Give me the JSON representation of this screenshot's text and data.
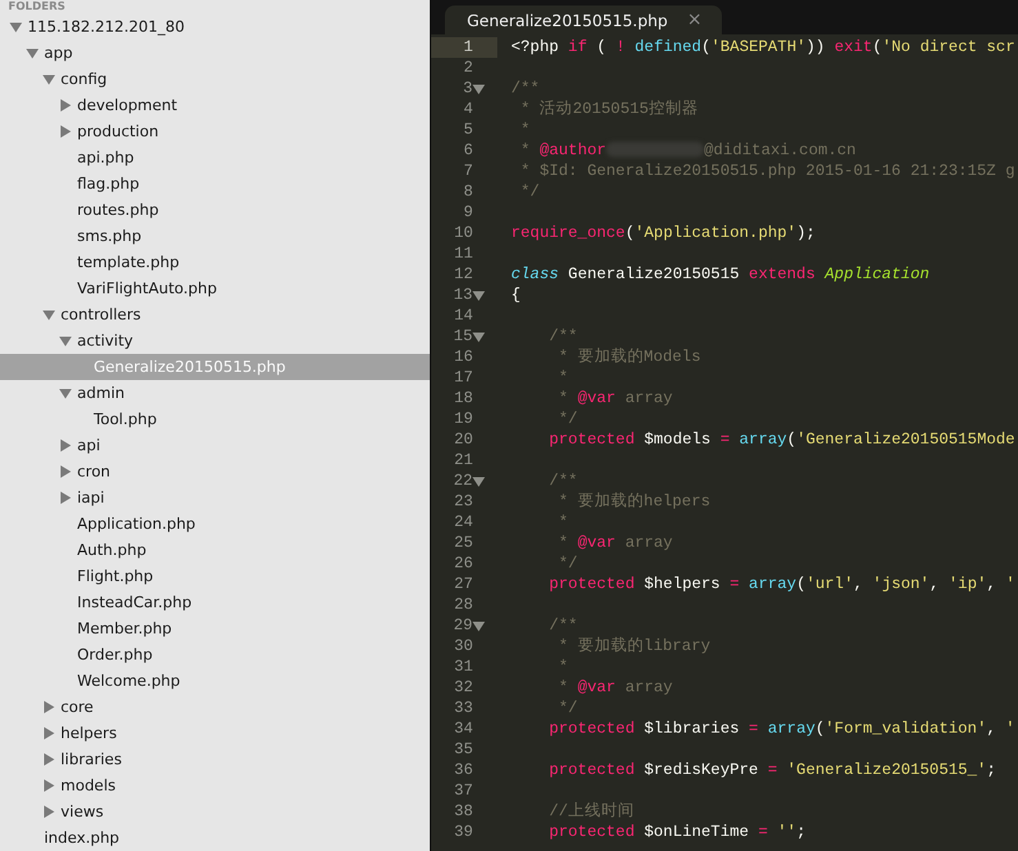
{
  "sidebar": {
    "header": "FOLDERS",
    "tree": [
      {
        "label": "115.182.212.201_80",
        "kind": "folder",
        "expanded": true,
        "selected": false,
        "children": [
          {
            "label": "app",
            "kind": "folder",
            "expanded": true,
            "selected": false,
            "children": [
              {
                "label": "config",
                "kind": "folder",
                "expanded": true,
                "selected": false,
                "children": [
                  {
                    "label": "development",
                    "kind": "folder",
                    "expanded": false,
                    "selected": false
                  },
                  {
                    "label": "production",
                    "kind": "folder",
                    "expanded": false,
                    "selected": false
                  },
                  {
                    "label": "api.php",
                    "kind": "file",
                    "selected": false
                  },
                  {
                    "label": "flag.php",
                    "kind": "file",
                    "selected": false
                  },
                  {
                    "label": "routes.php",
                    "kind": "file",
                    "selected": false
                  },
                  {
                    "label": "sms.php",
                    "kind": "file",
                    "selected": false
                  },
                  {
                    "label": "template.php",
                    "kind": "file",
                    "selected": false
                  },
                  {
                    "label": "VariFlightAuto.php",
                    "kind": "file",
                    "selected": false
                  }
                ]
              },
              {
                "label": "controllers",
                "kind": "folder",
                "expanded": true,
                "selected": false,
                "children": [
                  {
                    "label": "activity",
                    "kind": "folder",
                    "expanded": true,
                    "selected": false,
                    "children": [
                      {
                        "label": "Generalize20150515.php",
                        "kind": "file",
                        "selected": true
                      }
                    ]
                  },
                  {
                    "label": "admin",
                    "kind": "folder",
                    "expanded": true,
                    "selected": false,
                    "children": [
                      {
                        "label": "Tool.php",
                        "kind": "file",
                        "selected": false
                      }
                    ]
                  },
                  {
                    "label": "api",
                    "kind": "folder",
                    "expanded": false,
                    "selected": false
                  },
                  {
                    "label": "cron",
                    "kind": "folder",
                    "expanded": false,
                    "selected": false
                  },
                  {
                    "label": "iapi",
                    "kind": "folder",
                    "expanded": false,
                    "selected": false
                  },
                  {
                    "label": "Application.php",
                    "kind": "file",
                    "selected": false
                  },
                  {
                    "label": "Auth.php",
                    "kind": "file",
                    "selected": false
                  },
                  {
                    "label": "Flight.php",
                    "kind": "file",
                    "selected": false
                  },
                  {
                    "label": "InsteadCar.php",
                    "kind": "file",
                    "selected": false
                  },
                  {
                    "label": "Member.php",
                    "kind": "file",
                    "selected": false
                  },
                  {
                    "label": "Order.php",
                    "kind": "file",
                    "selected": false
                  },
                  {
                    "label": "Welcome.php",
                    "kind": "file",
                    "selected": false
                  }
                ]
              },
              {
                "label": "core",
                "kind": "folder",
                "expanded": false,
                "selected": false
              },
              {
                "label": "helpers",
                "kind": "folder",
                "expanded": false,
                "selected": false
              },
              {
                "label": "libraries",
                "kind": "folder",
                "expanded": false,
                "selected": false
              },
              {
                "label": "models",
                "kind": "folder",
                "expanded": false,
                "selected": false
              },
              {
                "label": "views",
                "kind": "folder",
                "expanded": false,
                "selected": false
              }
            ]
          },
          {
            "label": "index.php",
            "kind": "file",
            "selected": false
          }
        ]
      }
    ]
  },
  "editor": {
    "tabs": [
      {
        "label": "Generalize20150515.php",
        "close": "×",
        "selected": true
      }
    ],
    "lines": [
      {
        "number": "1",
        "fold": false,
        "current": true,
        "tokens": [
          {
            "kind": "plain",
            "text": "<?php "
          },
          {
            "kind": "keyword",
            "text": "if"
          },
          {
            "kind": "plain",
            "text": " ( "
          },
          {
            "kind": "keyword",
            "text": "! "
          },
          {
            "kind": "function",
            "text": "defined"
          },
          {
            "kind": "plain",
            "text": "("
          },
          {
            "kind": "string",
            "text": "'BASEPATH'"
          },
          {
            "kind": "plain",
            "text": ")) "
          },
          {
            "kind": "keyword",
            "text": "exit"
          },
          {
            "kind": "plain",
            "text": "("
          },
          {
            "kind": "string",
            "text": "'No direct scr"
          }
        ]
      },
      {
        "number": "2",
        "fold": false,
        "current": false
      },
      {
        "number": "3",
        "fold": true,
        "current": false,
        "tokens": [
          {
            "kind": "comment",
            "text": "/**"
          }
        ]
      },
      {
        "number": "4",
        "fold": false,
        "current": false,
        "tokens": [
          {
            "kind": "comment",
            "text": " * 活动20150515控制器"
          }
        ]
      },
      {
        "number": "5",
        "fold": false,
        "current": false,
        "tokens": [
          {
            "kind": "comment",
            "text": " *"
          }
        ]
      },
      {
        "number": "6",
        "fold": false,
        "current": false,
        "tokens": [
          {
            "kind": "comment",
            "text": " * "
          },
          {
            "kind": "tag",
            "text": "@author"
          },
          {
            "kind": "redacted"
          },
          {
            "kind": "comment",
            "text": "@diditaxi.com.cn"
          }
        ]
      },
      {
        "number": "7",
        "fold": false,
        "current": false,
        "tokens": [
          {
            "kind": "comment",
            "text": " * $Id: Generalize20150515.php 2015-01-16 21:23:15Z g"
          }
        ]
      },
      {
        "number": "8",
        "fold": false,
        "current": false,
        "tokens": [
          {
            "kind": "comment",
            "text": " */"
          }
        ]
      },
      {
        "number": "9",
        "fold": false,
        "current": false
      },
      {
        "number": "10",
        "fold": false,
        "current": false,
        "tokens": [
          {
            "kind": "keyword",
            "text": "require_once"
          },
          {
            "kind": "plain",
            "text": "("
          },
          {
            "kind": "string",
            "text": "'Application.php'"
          },
          {
            "kind": "plain",
            "text": ");"
          }
        ]
      },
      {
        "number": "11",
        "fold": false,
        "current": false
      },
      {
        "number": "12",
        "fold": false,
        "current": false,
        "tokens": [
          {
            "kind": "storage",
            "text": "class"
          },
          {
            "kind": "plain",
            "text": " Generalize20150515 "
          },
          {
            "kind": "keyword",
            "text": "extends "
          },
          {
            "kind": "inherited",
            "text": "Application"
          }
        ]
      },
      {
        "number": "13",
        "fold": true,
        "current": false,
        "tokens": [
          {
            "kind": "plain",
            "text": "{"
          }
        ]
      },
      {
        "number": "14",
        "fold": false,
        "current": false
      },
      {
        "number": "15",
        "fold": true,
        "current": false,
        "tokens": [
          {
            "kind": "comment",
            "text": "    /**"
          }
        ]
      },
      {
        "number": "16",
        "fold": false,
        "current": false,
        "tokens": [
          {
            "kind": "comment",
            "text": "     * 要加载的Models"
          }
        ]
      },
      {
        "number": "17",
        "fold": false,
        "current": false,
        "tokens": [
          {
            "kind": "comment",
            "text": "     *"
          }
        ]
      },
      {
        "number": "18",
        "fold": false,
        "current": false,
        "tokens": [
          {
            "kind": "comment",
            "text": "     * "
          },
          {
            "kind": "tag",
            "text": "@var"
          },
          {
            "kind": "comment",
            "text": " array"
          }
        ]
      },
      {
        "number": "19",
        "fold": false,
        "current": false,
        "tokens": [
          {
            "kind": "comment",
            "text": "     */"
          }
        ]
      },
      {
        "number": "20",
        "fold": false,
        "current": false,
        "tokens": [
          {
            "kind": "keyword",
            "text": "    protected"
          },
          {
            "kind": "plain",
            "text": " $models "
          },
          {
            "kind": "keyword",
            "text": "= "
          },
          {
            "kind": "function",
            "text": "array"
          },
          {
            "kind": "plain",
            "text": "("
          },
          {
            "kind": "string",
            "text": "'Generalize20150515Mode"
          }
        ]
      },
      {
        "number": "21",
        "fold": false,
        "current": false
      },
      {
        "number": "22",
        "fold": true,
        "current": false,
        "tokens": [
          {
            "kind": "comment",
            "text": "    /**"
          }
        ]
      },
      {
        "number": "23",
        "fold": false,
        "current": false,
        "tokens": [
          {
            "kind": "comment",
            "text": "     * 要加载的helpers"
          }
        ]
      },
      {
        "number": "24",
        "fold": false,
        "current": false,
        "tokens": [
          {
            "kind": "comment",
            "text": "     *"
          }
        ]
      },
      {
        "number": "25",
        "fold": false,
        "current": false,
        "tokens": [
          {
            "kind": "comment",
            "text": "     * "
          },
          {
            "kind": "tag",
            "text": "@var"
          },
          {
            "kind": "comment",
            "text": " array"
          }
        ]
      },
      {
        "number": "26",
        "fold": false,
        "current": false,
        "tokens": [
          {
            "kind": "comment",
            "text": "     */"
          }
        ]
      },
      {
        "number": "27",
        "fold": false,
        "current": false,
        "tokens": [
          {
            "kind": "keyword",
            "text": "    protected"
          },
          {
            "kind": "plain",
            "text": " $helpers "
          },
          {
            "kind": "keyword",
            "text": "= "
          },
          {
            "kind": "function",
            "text": "array"
          },
          {
            "kind": "plain",
            "text": "("
          },
          {
            "kind": "string",
            "text": "'url'"
          },
          {
            "kind": "plain",
            "text": ", "
          },
          {
            "kind": "string",
            "text": "'json'"
          },
          {
            "kind": "plain",
            "text": ", "
          },
          {
            "kind": "string",
            "text": "'ip'"
          },
          {
            "kind": "plain",
            "text": ", "
          },
          {
            "kind": "string",
            "text": "'"
          }
        ]
      },
      {
        "number": "28",
        "fold": false,
        "current": false
      },
      {
        "number": "29",
        "fold": true,
        "current": false,
        "tokens": [
          {
            "kind": "comment",
            "text": "    /**"
          }
        ]
      },
      {
        "number": "30",
        "fold": false,
        "current": false,
        "tokens": [
          {
            "kind": "comment",
            "text": "     * 要加载的library"
          }
        ]
      },
      {
        "number": "31",
        "fold": false,
        "current": false,
        "tokens": [
          {
            "kind": "comment",
            "text": "     *"
          }
        ]
      },
      {
        "number": "32",
        "fold": false,
        "current": false,
        "tokens": [
          {
            "kind": "comment",
            "text": "     * "
          },
          {
            "kind": "tag",
            "text": "@var"
          },
          {
            "kind": "comment",
            "text": " array"
          }
        ]
      },
      {
        "number": "33",
        "fold": false,
        "current": false,
        "tokens": [
          {
            "kind": "comment",
            "text": "     */"
          }
        ]
      },
      {
        "number": "34",
        "fold": false,
        "current": false,
        "tokens": [
          {
            "kind": "keyword",
            "text": "    protected"
          },
          {
            "kind": "plain",
            "text": " $libraries "
          },
          {
            "kind": "keyword",
            "text": "= "
          },
          {
            "kind": "function",
            "text": "array"
          },
          {
            "kind": "plain",
            "text": "("
          },
          {
            "kind": "string",
            "text": "'Form_validation'"
          },
          {
            "kind": "plain",
            "text": ", "
          },
          {
            "kind": "string",
            "text": "'"
          }
        ]
      },
      {
        "number": "35",
        "fold": false,
        "current": false
      },
      {
        "number": "36",
        "fold": false,
        "current": false,
        "tokens": [
          {
            "kind": "keyword",
            "text": "    protected"
          },
          {
            "kind": "plain",
            "text": " $redisKeyPre "
          },
          {
            "kind": "keyword",
            "text": "= "
          },
          {
            "kind": "string",
            "text": "'Generalize20150515_'"
          },
          {
            "kind": "plain",
            "text": ";"
          }
        ]
      },
      {
        "number": "37",
        "fold": false,
        "current": false
      },
      {
        "number": "38",
        "fold": false,
        "current": false,
        "tokens": [
          {
            "kind": "comment",
            "text": "    //上线时间"
          }
        ]
      },
      {
        "number": "39",
        "fold": false,
        "current": false,
        "tokens": [
          {
            "kind": "keyword",
            "text": "    protected"
          },
          {
            "kind": "plain",
            "text": " $onLineTime "
          },
          {
            "kind": "keyword",
            "text": "= "
          },
          {
            "kind": "string",
            "text": "''"
          },
          {
            "kind": "plain",
            "text": ";"
          }
        ]
      }
    ]
  }
}
